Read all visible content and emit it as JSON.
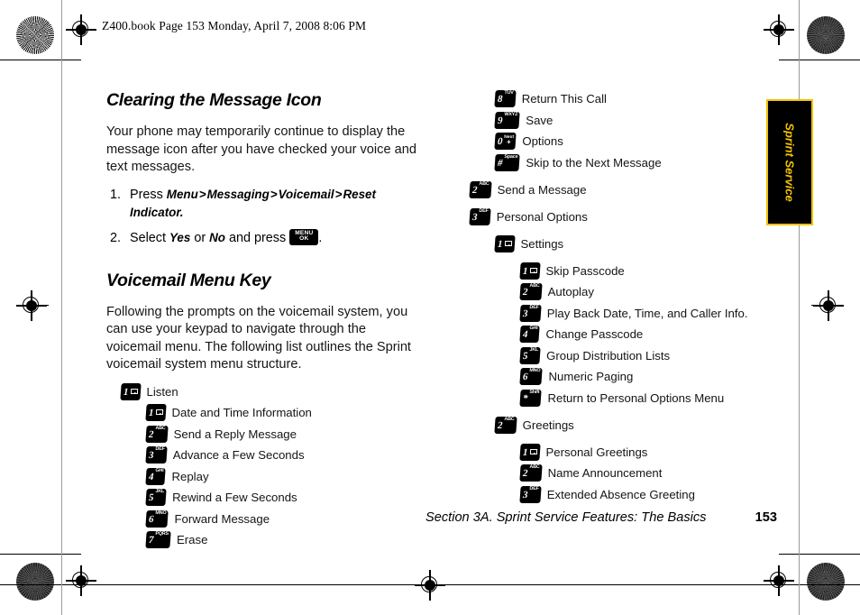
{
  "document": {
    "header_line": "Z400.book  Page 153  Monday, April 7, 2008  8:06 PM",
    "side_tab": "Sprint Service",
    "footer_section": "Section 3A. Sprint Service Features: The Basics",
    "footer_page": "153"
  },
  "left_column": {
    "heading1": "Clearing the Message Icon",
    "paragraph1": "Your phone may temporarily continue to display the message icon after you have checked your voice and text messages.",
    "steps": [
      {
        "num": "1.",
        "prefix": "Press ",
        "path": [
          "Menu",
          "Messaging",
          "Voicemail",
          "Reset Indicator."
        ],
        "separator": ">"
      },
      {
        "num": "2.",
        "prefix": "Select ",
        "option_a": "Yes",
        "mid": " or ",
        "option_b": "No",
        "suffix": " and press ",
        "key_line1": "MENU",
        "key_line2": "OK",
        "period": "."
      }
    ],
    "heading2": "Voicemail Menu Key",
    "paragraph2": "Following the prompts on the voicemail system, you can use your keypad to navigate through the voicemail menu. The following list outlines the Sprint voicemail system menu structure.",
    "menu": [
      {
        "level": 0,
        "digit": "1",
        "sub": "envelope",
        "label": "Listen"
      },
      {
        "level": 1,
        "digit": "1",
        "sub": "envelope",
        "label": "Date and Time Information"
      },
      {
        "level": 1,
        "digit": "2",
        "sub": "ABC",
        "label": "Send a Reply Message"
      },
      {
        "level": 1,
        "digit": "3",
        "sub": "DEF",
        "label": "Advance a Few Seconds"
      },
      {
        "level": 1,
        "digit": "4",
        "sub": "GHI",
        "label": "Replay"
      },
      {
        "level": 1,
        "digit": "5",
        "sub": "JKL",
        "label": "Rewind a Few Seconds"
      },
      {
        "level": 1,
        "digit": "6",
        "sub": "MNO",
        "label": "Forward Message"
      },
      {
        "level": 1,
        "digit": "7",
        "sub": "PQRS",
        "label": "Erase"
      }
    ]
  },
  "right_column": {
    "menu": [
      {
        "level": 1,
        "digit": "8",
        "sub": "TUV",
        "label": "Return This Call",
        "gap": false
      },
      {
        "level": 1,
        "digit": "9",
        "sub": "WXYZ",
        "label": "Save",
        "gap": false
      },
      {
        "level": 1,
        "digit": "0",
        "sub": "stack-next-plus",
        "label": "Options",
        "gap": false
      },
      {
        "level": 1,
        "digit": "#",
        "sub": "Space",
        "label": "Skip to the Next Message",
        "gap": false
      },
      {
        "level": 0,
        "digit": "2",
        "sub": "ABC",
        "label": "Send a Message",
        "gap": true
      },
      {
        "level": 0,
        "digit": "3",
        "sub": "DEF",
        "label": "Personal Options",
        "gap": true
      },
      {
        "level": 1,
        "digit": "1",
        "sub": "envelope",
        "label": "Settings",
        "gap": true
      },
      {
        "level": 2,
        "digit": "1",
        "sub": "envelope",
        "label": "Skip Passcode",
        "gap": true
      },
      {
        "level": 2,
        "digit": "2",
        "sub": "ABC",
        "label": "Autoplay",
        "gap": false
      },
      {
        "level": 2,
        "digit": "3",
        "sub": "DEF",
        "label": "Play Back Date, Time, and Caller Info.",
        "gap": false
      },
      {
        "level": 2,
        "digit": "4",
        "sub": "GHI",
        "label": "Change Passcode",
        "gap": false
      },
      {
        "level": 2,
        "digit": "5",
        "sub": "JKL",
        "label": "Group Distribution Lists",
        "gap": false
      },
      {
        "level": 2,
        "digit": "6",
        "sub": "MNO",
        "label": "Numeric Paging",
        "gap": false
      },
      {
        "level": 2,
        "digit": "*",
        "sub": "Shift",
        "label": "Return to Personal Options Menu",
        "gap": false
      },
      {
        "level": 1,
        "digit": "2",
        "sub": "ABC",
        "label": "Greetings",
        "gap": true
      },
      {
        "level": 2,
        "digit": "1",
        "sub": "envelope",
        "label": "Personal Greetings",
        "gap": true
      },
      {
        "level": 2,
        "digit": "2",
        "sub": "ABC",
        "label": "Name Announcement",
        "gap": false
      },
      {
        "level": 2,
        "digit": "3",
        "sub": "DEF",
        "label": "Extended Absence Greeting",
        "gap": false
      }
    ]
  },
  "colors": {
    "tab_background": "#000000",
    "tab_accent": "#f2c200",
    "text": "#000000"
  }
}
